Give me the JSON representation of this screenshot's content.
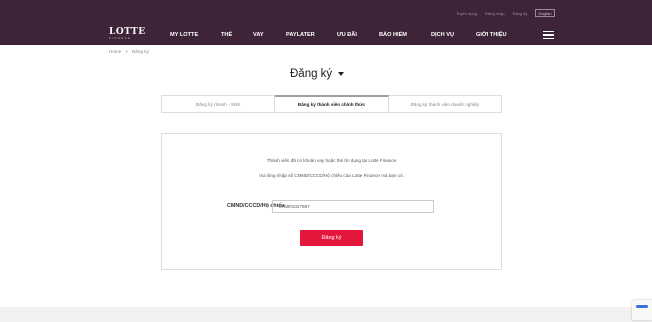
{
  "header": {
    "utility": [
      "Tuyển dụng",
      "Đăng nhập",
      "Đăng ký"
    ],
    "lang": "English",
    "logo": "LOTTE",
    "logo_sub": "FINANCE",
    "nav": [
      "MY LOTTE",
      "THẺ",
      "VAY",
      "PAYLATER",
      "ƯU ĐÃI",
      "BẢO HIỂM",
      "DỊCH VỤ",
      "GIỚI THIỆU"
    ]
  },
  "breadcrumb": [
    "Home",
    ">",
    "Đăng ký"
  ],
  "title": "Đăng ký",
  "tabs": [
    "Đăng ký nhanh - SNS",
    "Đăng ký thành viên chính thức",
    "Đăng ký thành viên doanh nghiệp"
  ],
  "form": {
    "desc1": "Thành viên đã có khoản vay hoặc thẻ tín dụng tại Lotte Finance",
    "desc2": "Vui lòng nhập số CMND/CCCD/Hộ chiếu của Lotte Finance mà bạn có.",
    "id_label": "CMND/CCCD/Hộ chiếu",
    "id_value": "075901027587",
    "submit": "Đăng ký"
  },
  "colors": {
    "header_bg": "#3e2438",
    "accent": "#e3173c"
  }
}
